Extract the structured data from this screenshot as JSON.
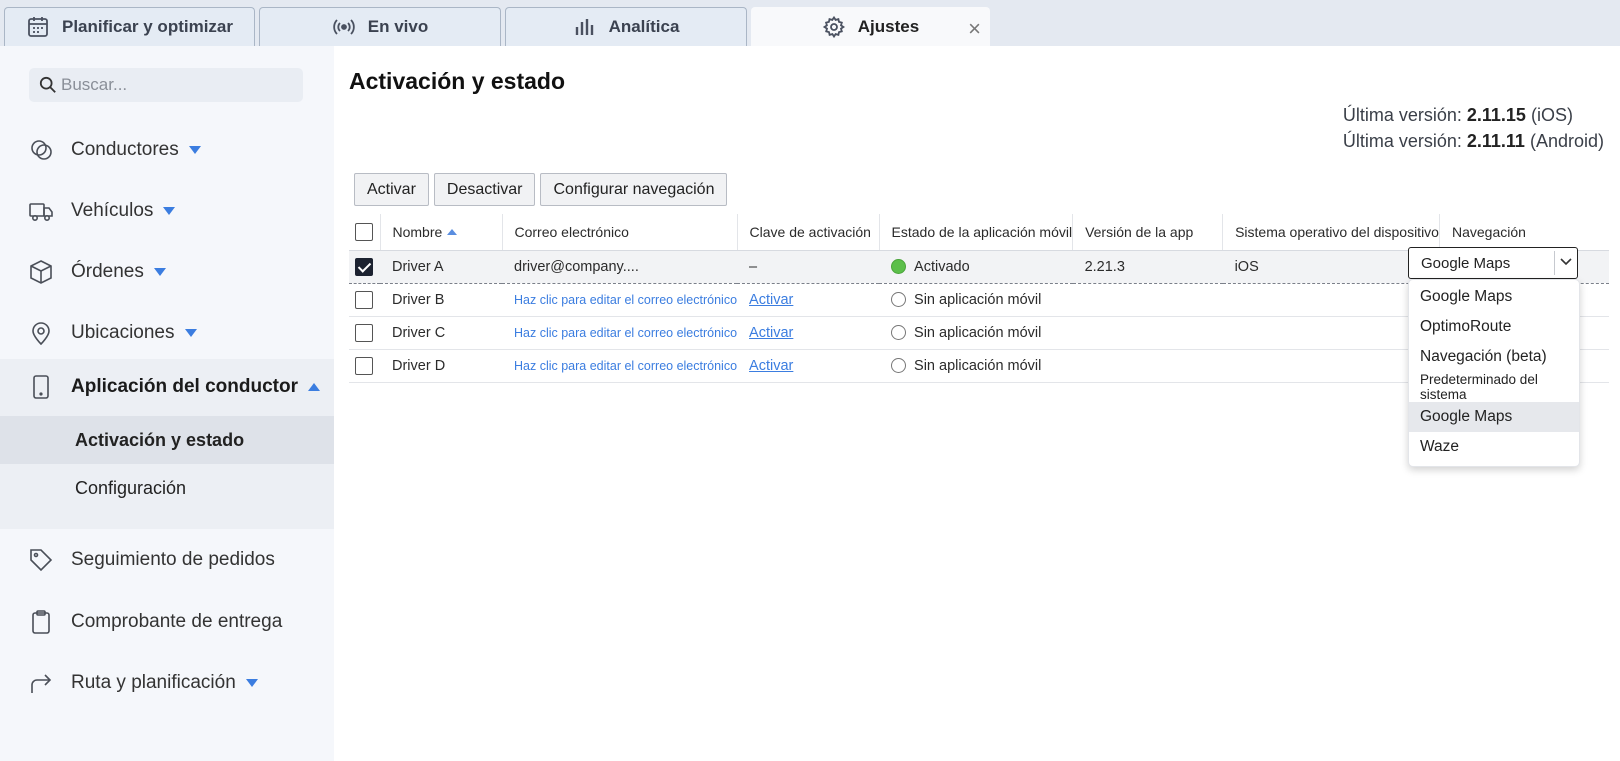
{
  "tabs": [
    {
      "label": "Planificar y optimizar",
      "icon": "calendar-icon"
    },
    {
      "label": "En vivo",
      "icon": "broadcast-icon"
    },
    {
      "label": "Analítica",
      "icon": "bar-chart-icon"
    },
    {
      "label": "Ajustes",
      "icon": "gear-icon",
      "active": true
    }
  ],
  "tab_close": "×",
  "sidebar": {
    "search_placeholder": "Buscar...",
    "items": [
      {
        "label": "Conductores",
        "icon": "drivers-icon"
      },
      {
        "label": "Vehículos",
        "icon": "truck-icon"
      },
      {
        "label": "Órdenes",
        "icon": "box-icon"
      },
      {
        "label": "Ubicaciones",
        "icon": "location-pin-icon"
      },
      {
        "label": "Aplicación del conductor",
        "icon": "phone-icon"
      },
      {
        "label": "Seguimiento de pedidos",
        "icon": "tag-icon"
      },
      {
        "label": "Comprobante de entrega",
        "icon": "clipboard-icon"
      },
      {
        "label": "Ruta y planificación",
        "icon": "route-arrow-icon"
      }
    ],
    "subitems": [
      {
        "label": "Activación y estado"
      },
      {
        "label": "Configuración"
      }
    ]
  },
  "main": {
    "title": "Activación y estado",
    "version_prefix": "Última versión:",
    "ios_version": "2.11.15",
    "ios_label": "(iOS)",
    "android_version": "2.11.11",
    "android_label": "(Android)",
    "buttons": {
      "activate": "Activar",
      "deactivate": "Desactivar",
      "configure_nav": "Configurar navegación"
    },
    "columns": [
      "Nombre",
      "Correo electrónico",
      "Clave de activación",
      "Estado de la aplicación móvil",
      "Versión de la app",
      "Sistema operativo del dispositivo",
      "Navegación"
    ],
    "rows": [
      {
        "name": "Driver A",
        "email": "driver@company....",
        "key": "–",
        "status": "Activado",
        "app_version": "2.21.3",
        "os": "iOS"
      },
      {
        "name": "Driver B",
        "email": "Haz clic para editar el correo electrónico",
        "key": "Activar",
        "status": "Sin aplicación móvil",
        "app_version": "",
        "os": ""
      },
      {
        "name": "Driver C",
        "email": "Haz clic para editar el correo electrónico",
        "key": "Activar",
        "status": "Sin aplicación móvil",
        "app_version": "",
        "os": ""
      },
      {
        "name": "Driver D",
        "email": "Haz clic para editar el correo electrónico",
        "key": "Activar",
        "status": "Sin aplicación móvil",
        "app_version": "",
        "os": ""
      }
    ],
    "navigation_select": {
      "value": "Google Maps",
      "options": [
        "Google Maps",
        "OptimoRoute",
        "Navegación (beta)",
        "Predeterminado del sistema",
        "Google Maps",
        "Waze"
      ]
    }
  },
  "colors": {
    "accent": "#3b7de0",
    "status_active": "#5cbf4a",
    "sidebar_bg": "#f5f7fb",
    "tabbar_bg": "#e4e9f1"
  }
}
